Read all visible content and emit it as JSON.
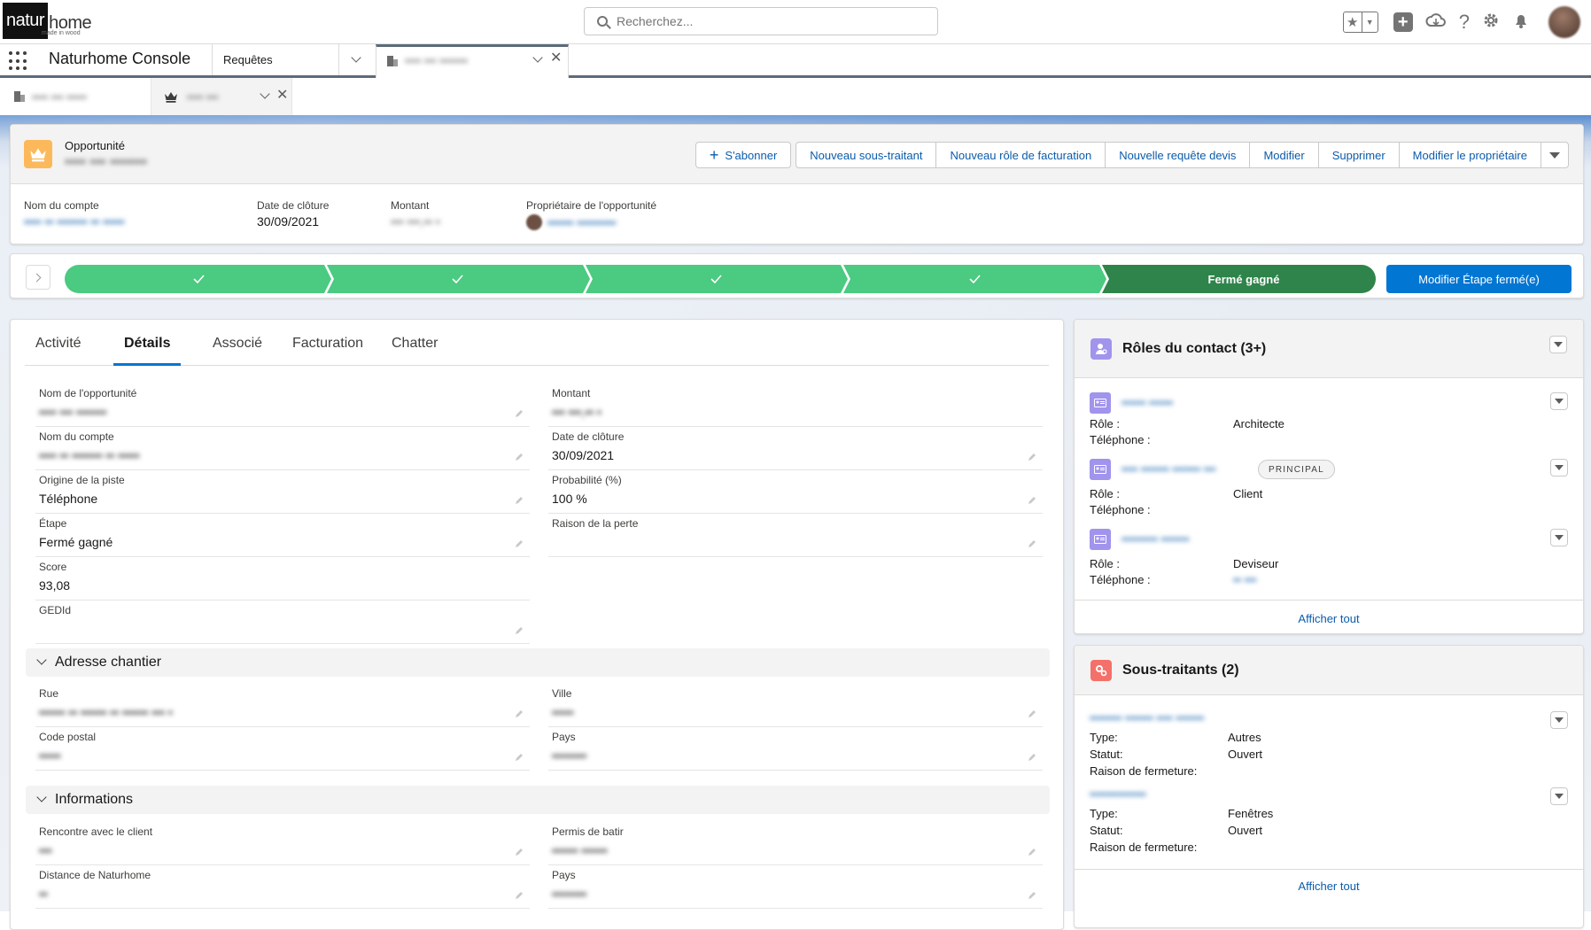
{
  "header": {
    "logo_dark": "natur",
    "logo_light": "home",
    "logo_sub": "made in wood",
    "search_placeholder": "Recherchez..."
  },
  "nav": {
    "app_name": "Naturhome Console",
    "object_tab": "Requêtes",
    "record_tab_label": "•••• ••• •••••••"
  },
  "subtabs": [
    {
      "label": "•••• ••• •••••"
    },
    {
      "label": "•••• •••"
    }
  ],
  "record": {
    "type_label": "Opportunité",
    "name": "•••• ••• •••••••",
    "actions": {
      "subscribe": "S'abonner",
      "new_subcontractor": "Nouveau sous-traitant",
      "new_billing_role": "Nouveau rôle de facturation",
      "new_quote_request": "Nouvelle requête devis",
      "edit": "Modifier",
      "delete": "Supprimer",
      "change_owner": "Modifier le propriétaire"
    },
    "highlights": [
      {
        "label": "Nom du compte",
        "value": "•••• •• ••••••• •• •••••"
      },
      {
        "label": "Date de clôture",
        "value": "30/09/2021"
      },
      {
        "label": "Montant",
        "value": "••• •••,•• •"
      },
      {
        "label": "Propriétaire de l'opportunité",
        "value": "•••••• •••••••••"
      }
    ]
  },
  "path": {
    "completed_steps": 4,
    "current_stage": "Fermé gagné",
    "action_button": "Modifier Étape fermé(e)"
  },
  "tabs": [
    "Activité",
    "Détails",
    "Associé",
    "Facturation",
    "Chatter"
  ],
  "active_tab": "Détails",
  "details": {
    "left": [
      {
        "label": "Nom de l'opportunité",
        "value": "•••• ••• •••••••",
        "blurred": true
      },
      {
        "label": "Nom du compte",
        "value": "•••• •• ••••••• •• •••••",
        "link": true
      },
      {
        "label": "Origine de la piste",
        "value": "Téléphone"
      },
      {
        "label": "Étape",
        "value": "Fermé gagné"
      },
      {
        "label": "Score",
        "value": "93,08"
      },
      {
        "label": "GEDId",
        "value": ""
      }
    ],
    "right": [
      {
        "label": "Montant",
        "value": "••• •••,•• •",
        "blurred": true
      },
      {
        "label": "Date de clôture",
        "value": "30/09/2021"
      },
      {
        "label": "Probabilité (%)",
        "value": "100 %"
      },
      {
        "label": "Raison de la perte",
        "value": ""
      }
    ]
  },
  "sections": {
    "address": {
      "title": "Adresse chantier",
      "left": [
        {
          "label": "Rue",
          "value": "•••••• •• •••••• •• •••••• ••• •"
        },
        {
          "label": "Code postal",
          "value": "•••••"
        }
      ],
      "right": [
        {
          "label": "Ville",
          "value": "•••••"
        },
        {
          "label": "Pays",
          "value": "••••••••"
        }
      ]
    },
    "info": {
      "title": "Informations",
      "left": [
        {
          "label": "Rencontre avec le client",
          "value": "•••"
        },
        {
          "label": "Distance de Naturhome",
          "value": "••"
        }
      ],
      "right": [
        {
          "label": "Permis de batir",
          "value": "•••••• ••••••"
        },
        {
          "label": "Pays",
          "value": "••••••••"
        }
      ]
    }
  },
  "contact_roles": {
    "title": "Rôles du contact (3+)",
    "role_label": "Rôle :",
    "phone_label": "Téléphone :",
    "items": [
      {
        "name": "•••••• ••••••",
        "role": "Architecte",
        "phone": ""
      },
      {
        "name": "•••• ••••••• ••••••• •••",
        "role": "Client",
        "phone": "",
        "badge": "PRINCIPAL"
      },
      {
        "name": "••••••••• •••••••",
        "role": "Deviseur",
        "phone": "•• •••"
      }
    ],
    "show_all": "Afficher tout"
  },
  "subcontractors": {
    "title": "Sous-traitants (2)",
    "type_label": "Type:",
    "status_label": "Statut:",
    "close_reason_label": "Raison de fermeture:",
    "items": [
      {
        "name": "•••••••• ••••••• •••• •••••••",
        "type": "Autres",
        "status": "Ouvert"
      },
      {
        "name": "••••••••••••••",
        "type": "Fenêtres",
        "status": "Ouvert"
      }
    ],
    "show_all": "Afficher tout"
  },
  "colors": {
    "brand": "#0176d3",
    "path_complete": "#4bca81",
    "path_current": "#2e844a",
    "opportunity_icon": "#fcb95b",
    "contact_icon": "#a094ed",
    "subcontractor_icon": "#f4706a"
  }
}
